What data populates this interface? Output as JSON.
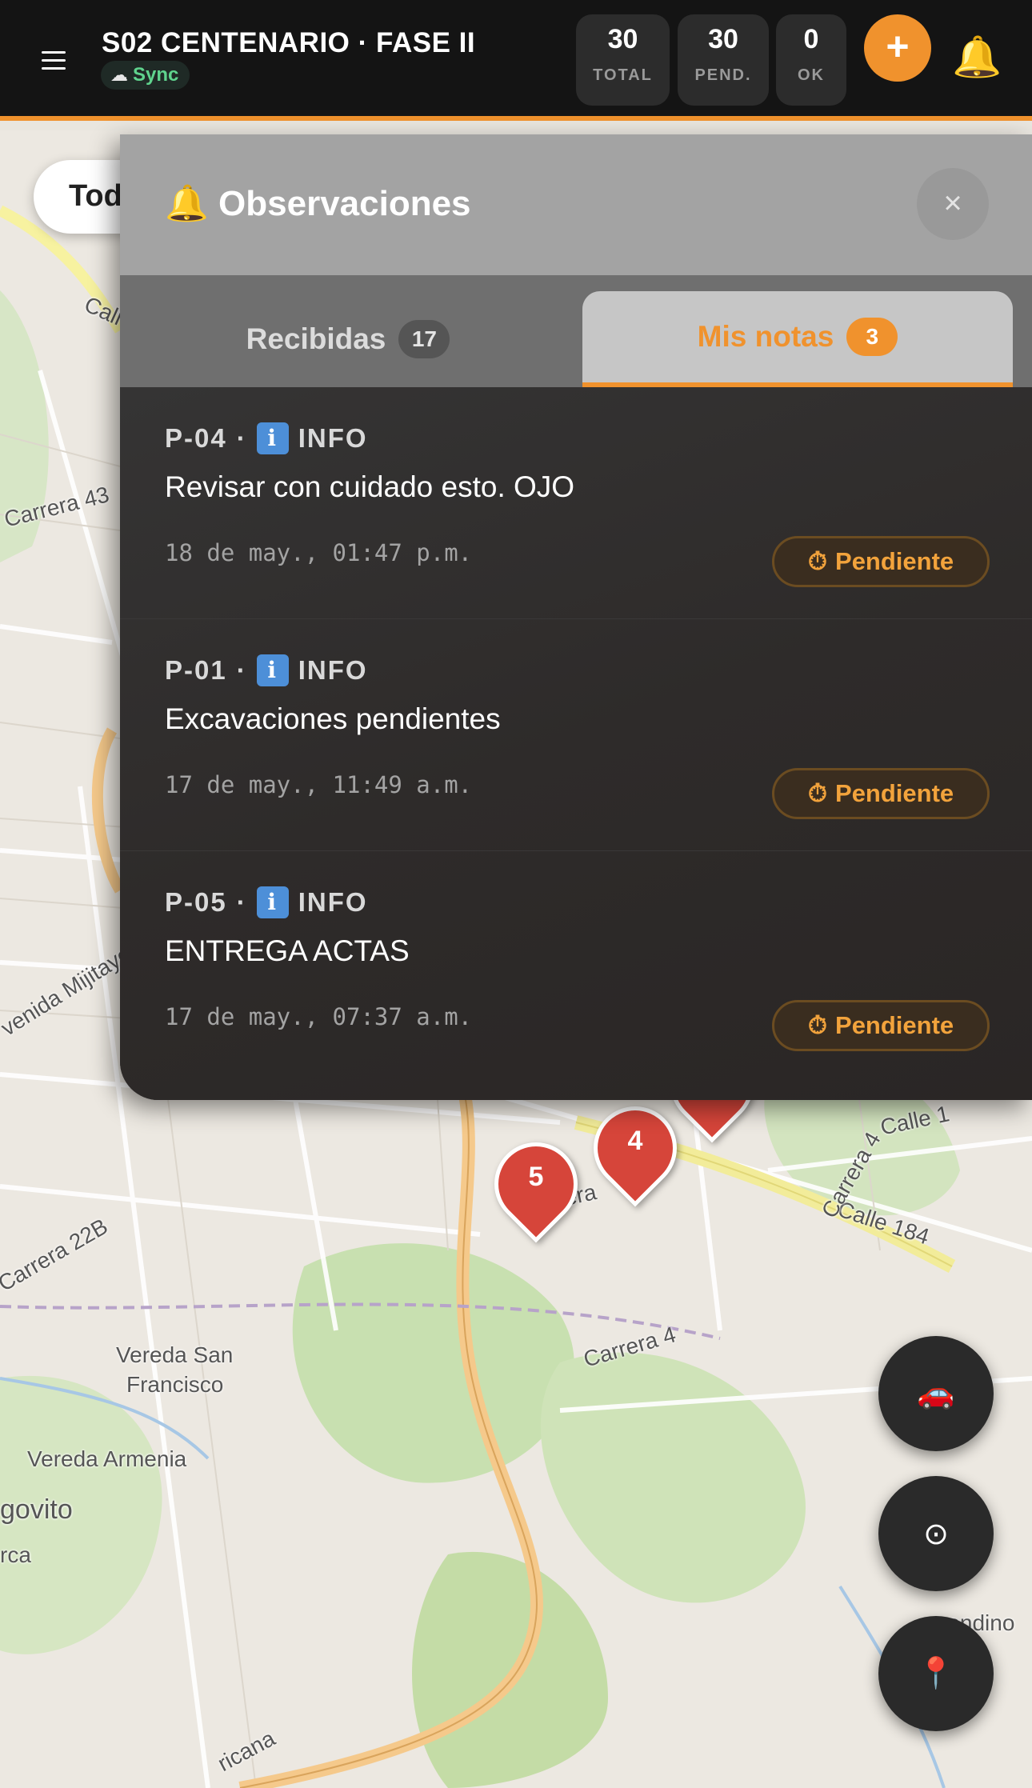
{
  "header": {
    "title": "S02 CENTENARIO · FASE II",
    "sync_label": "Sync",
    "stats": [
      {
        "value": "30",
        "label": "TOTAL"
      },
      {
        "value": "30",
        "label": "PEND."
      },
      {
        "value": "0",
        "label": "OK"
      }
    ],
    "add_label": "+",
    "bell_icon": "🔔"
  },
  "map": {
    "filter_label": "Tod",
    "labels": [
      "Call",
      "Carrera 43",
      "venida Mijitayo",
      "Carrera 22B",
      "Vereda San",
      "Francisco",
      "Vereda Armenia",
      "govito",
      "rca",
      "Calle 184",
      "Carrera 4",
      "Carrera 4",
      "era",
      "Calle 1",
      "ricana",
      "rendino"
    ],
    "markers": [
      "5",
      "4"
    ],
    "fab_icons": [
      "🚗",
      "⊙",
      "📍"
    ]
  },
  "panel": {
    "title": "Observaciones",
    "title_icon": "🔔",
    "close_label": "×",
    "tabs": [
      {
        "label": "Recibidas",
        "count": "17"
      },
      {
        "label": "Mis notas",
        "count": "3"
      }
    ],
    "notes": [
      {
        "point": "P-04",
        "type": "INFO",
        "text": "Revisar con cuidado esto. OJO",
        "time": "18 de may., 01:47 p.m.",
        "status": "Pendiente"
      },
      {
        "point": "P-01",
        "type": "INFO",
        "text": "Excavaciones pendientes",
        "time": "17 de may., 11:49 a.m.",
        "status": "Pendiente"
      },
      {
        "point": "P-05",
        "type": "INFO",
        "text": "ENTREGA ACTAS",
        "time": "17 de may., 07:37 a.m.",
        "status": "Pendiente"
      }
    ]
  },
  "colors": {
    "accent": "#f0922d",
    "marker": "#d6453a",
    "sync": "#5fd38d",
    "info": "#4d8fd8"
  }
}
